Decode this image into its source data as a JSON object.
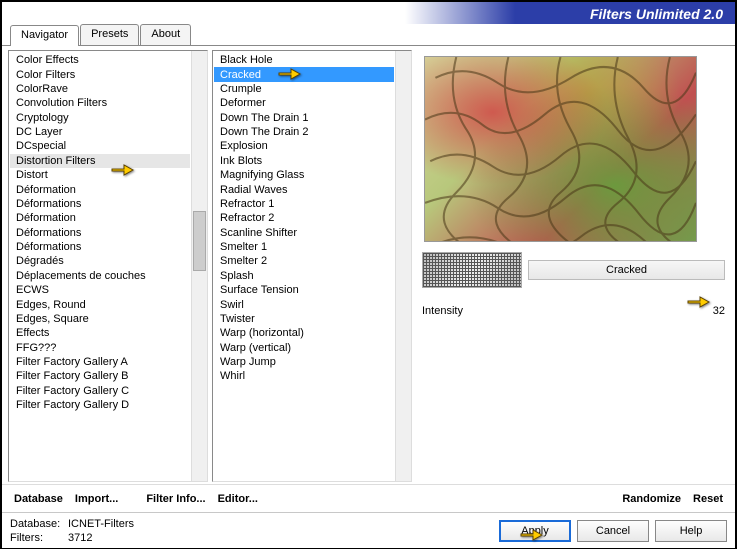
{
  "app_title": "Filters Unlimited 2.0",
  "tabs": {
    "t0": "Navigator",
    "t1": "Presets",
    "t2": "About"
  },
  "categories": [
    "Color Effects",
    "Color Filters",
    "ColorRave",
    "Convolution Filters",
    "Cryptology",
    "DC Layer",
    "DCspecial",
    "Distortion Filters",
    "Distort",
    "Déformation",
    "Déformations",
    "Déformation",
    "Déformations",
    "Déformations",
    "Dégradés",
    "Déplacements de couches",
    "ECWS",
    "Edges, Round",
    "Edges, Square",
    "Effects",
    "FFG???",
    "Filter Factory Gallery A",
    "Filter Factory Gallery B",
    "Filter Factory Gallery C",
    "Filter Factory Gallery D"
  ],
  "category_selected_index": 7,
  "effects": [
    "Black Hole",
    "Cracked",
    "Crumple",
    "Deformer",
    "Down The Drain 1",
    "Down The Drain 2",
    "Explosion",
    "Ink Blots",
    "Magnifying Glass",
    "Radial Waves",
    "Refractor 1",
    "Refractor 2",
    "Scanline Shifter",
    "Smelter 1",
    "Smelter 2",
    "Splash",
    "Surface Tension",
    "Swirl",
    "Twister",
    "Warp (horizontal)",
    "Warp (vertical)",
    "Warp Jump",
    "Whirl"
  ],
  "effect_selected_index": 1,
  "effect_name": "Cracked",
  "slider": {
    "label": "Intensity",
    "value": "32"
  },
  "toolbar": {
    "database": "Database",
    "import": "Import...",
    "filterinfo": "Filter Info...",
    "editor": "Editor...",
    "randomize": "Randomize",
    "reset": "Reset"
  },
  "status": {
    "db_label": "Database:",
    "db_value": "ICNET-Filters",
    "filters_label": "Filters:",
    "filters_value": "3712"
  },
  "actions": {
    "apply": "Apply",
    "cancel": "Cancel",
    "help": "Help"
  }
}
